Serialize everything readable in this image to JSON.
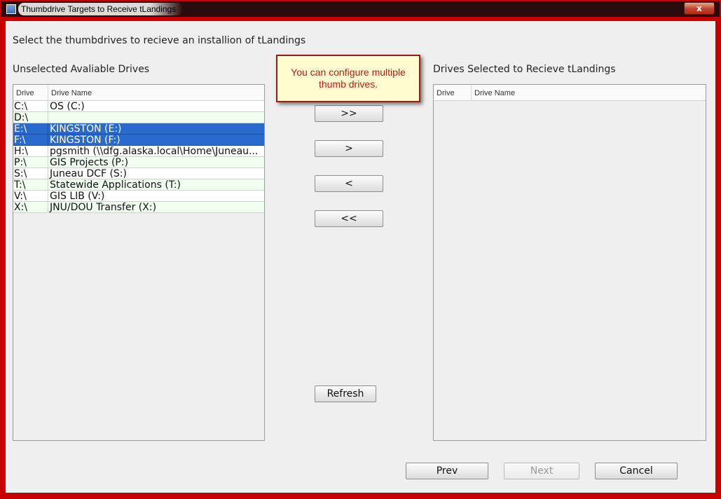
{
  "window": {
    "title": "Thumbdrive Targets to Receive tLandings",
    "close_label": "x"
  },
  "instruction": "Select the thumbdrives to recieve an installion of tLandings",
  "left_panel": {
    "label": "Unselected Avaliable Drives",
    "columns": [
      "Drive",
      "Drive Name"
    ],
    "rows": [
      {
        "drive": "C:\\",
        "name": "OS (C:)",
        "state": "white"
      },
      {
        "drive": "D:\\",
        "name": "",
        "state": "green"
      },
      {
        "drive": "E:\\",
        "name": "KINGSTON (E:)",
        "state": "selected"
      },
      {
        "drive": "F:\\",
        "name": "KINGSTON (F:)",
        "state": "selected"
      },
      {
        "drive": "H:\\",
        "name": "pgsmith (\\\\dfg.alaska.local\\Home\\Juneau...",
        "state": "white"
      },
      {
        "drive": "P:\\",
        "name": "GIS Projects (P:)",
        "state": "green"
      },
      {
        "drive": "S:\\",
        "name": "Juneau DCF (S:)",
        "state": "white"
      },
      {
        "drive": "T:\\",
        "name": "Statewide Applications (T:)",
        "state": "green"
      },
      {
        "drive": "V:\\",
        "name": "GIS LIB (V:)",
        "state": "white"
      },
      {
        "drive": "X:\\",
        "name": "JNU/DOU Transfer (X:)",
        "state": "green"
      }
    ]
  },
  "right_panel": {
    "label": "Drives Selected to Recieve tLandings",
    "columns": [
      "Drive",
      "Drive Name"
    ]
  },
  "tooltip": {
    "line1": "You can configure multiple",
    "line2": "thumb drives."
  },
  "transfer_buttons": {
    "move_all_right": ">>",
    "move_right": ">",
    "move_left": "<",
    "move_all_left": "<<",
    "refresh": "Refresh"
  },
  "footer": {
    "prev": "Prev",
    "next": "Next",
    "cancel": "Cancel"
  },
  "colors": {
    "selection": "#2a6acc",
    "tooltip_bg": "#fffdd0",
    "tooltip_text": "#c01818",
    "frame": "#c80000"
  }
}
